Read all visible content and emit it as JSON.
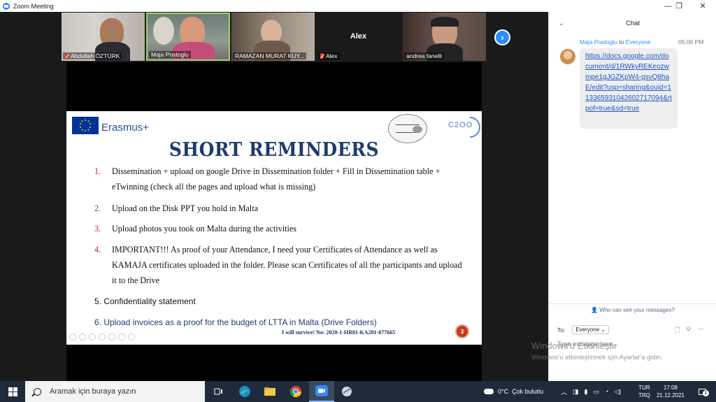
{
  "window": {
    "title": "Zoom Meeting",
    "minimize": "—",
    "maximize": "❐",
    "close": "✕"
  },
  "participants": [
    {
      "name": "Abdullah ÖZTÜRK",
      "muted": true
    },
    {
      "name": "Maja Postoglu",
      "muted": false
    },
    {
      "name": "RAMAZAN MURAT KUY...",
      "muted": true
    },
    {
      "name": "Alex",
      "muted": true,
      "video": false,
      "center_label": "Alex"
    },
    {
      "name": "andrea fanelli",
      "muted": false
    }
  ],
  "slide": {
    "brand": "Erasmus+",
    "partner_logo": "C2OO",
    "title": "SHORT REMINDERS",
    "items": [
      {
        "num": "1.",
        "text": "Dissemination + upload on google Drive in Dissemination folder + Fill in Dissemination table + eTwinning (check all the pages and upload what is missing)"
      },
      {
        "num": "2.",
        "text": " Upload on the Disk PPT you hold in Malta"
      },
      {
        "num": "3.",
        "text": "Upload photos you took on Malta during the activities"
      },
      {
        "num": "4.",
        "text": "IMPORTANT!!! As proof of your Attendance, I need your Certificates of Attendance as well as KAMAJA certificates uploaded in the folder. Please scan Certificates of all the participants and upload it to the Drive"
      }
    ],
    "item5": "5. Confidentiality statement",
    "item6": "6. Upload invoices as a proof for the budget of LTTA in Malta (Drive Folders)",
    "footer": "I will survive! No: 2020-1-HR01-KA201-077665",
    "page_number": "3"
  },
  "chat": {
    "title": "Chat",
    "sender": "Maja Postoglu",
    "to_word": "to",
    "recipient": "Everyone",
    "time": "05:06 PM",
    "link_lines": [
      "https://docs.google.com",
      "/document/d/1RWkyREK",
      "eozwmpe1gJGZKpW4-",
      "gsvQ8haE/edit?",
      "usp=sharing&ouid=",
      "11336593104260271709",
      "4&rtpof=true&sd=true"
    ],
    "who_can_see": "Who can see your messages?",
    "to_label": "To:",
    "to_value": "Everyone",
    "input_placeholder": "Type message here..."
  },
  "watermark": {
    "line1": "Windows'u Etkinleştir",
    "line2": "Windows'u etkinleştirmek için Ayarlar'a gidin."
  },
  "taskbar": {
    "search_placeholder": "Aramak için buraya yazın",
    "weather": "0°C  Çok bulutlu",
    "lang_top": "TUR",
    "lang_bottom": "TRQ",
    "time": "17:08",
    "date": "21.12.2021",
    "notifications": "1"
  }
}
